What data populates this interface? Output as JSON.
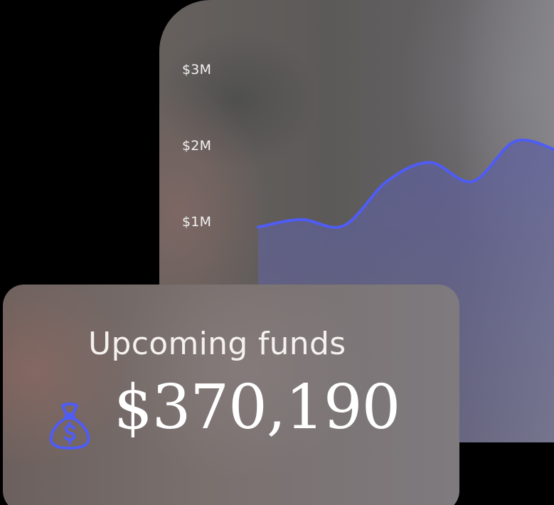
{
  "chart_data": {
    "type": "area",
    "title": "",
    "xlabel": "",
    "ylabel": "",
    "y_ticks": [
      "$1M",
      "$2M",
      "$3M"
    ],
    "ylim": [
      0,
      3
    ],
    "x": [
      0,
      1,
      2,
      3,
      4,
      5,
      6,
      7
    ],
    "series": [
      {
        "values": [
          0.95,
          1.05,
          0.97,
          1.55,
          1.8,
          1.55,
          2.08,
          1.95
        ]
      }
    ],
    "grid": false,
    "legend": "none"
  },
  "funds": {
    "title": "Upcoming funds",
    "amount": "$370,190",
    "icon": "money-bag-icon"
  },
  "colors": {
    "line": "#4f5cf5",
    "icon": "#4f5cf5",
    "area_fill": "#5c5ea0",
    "text": "#f4f1ef"
  }
}
